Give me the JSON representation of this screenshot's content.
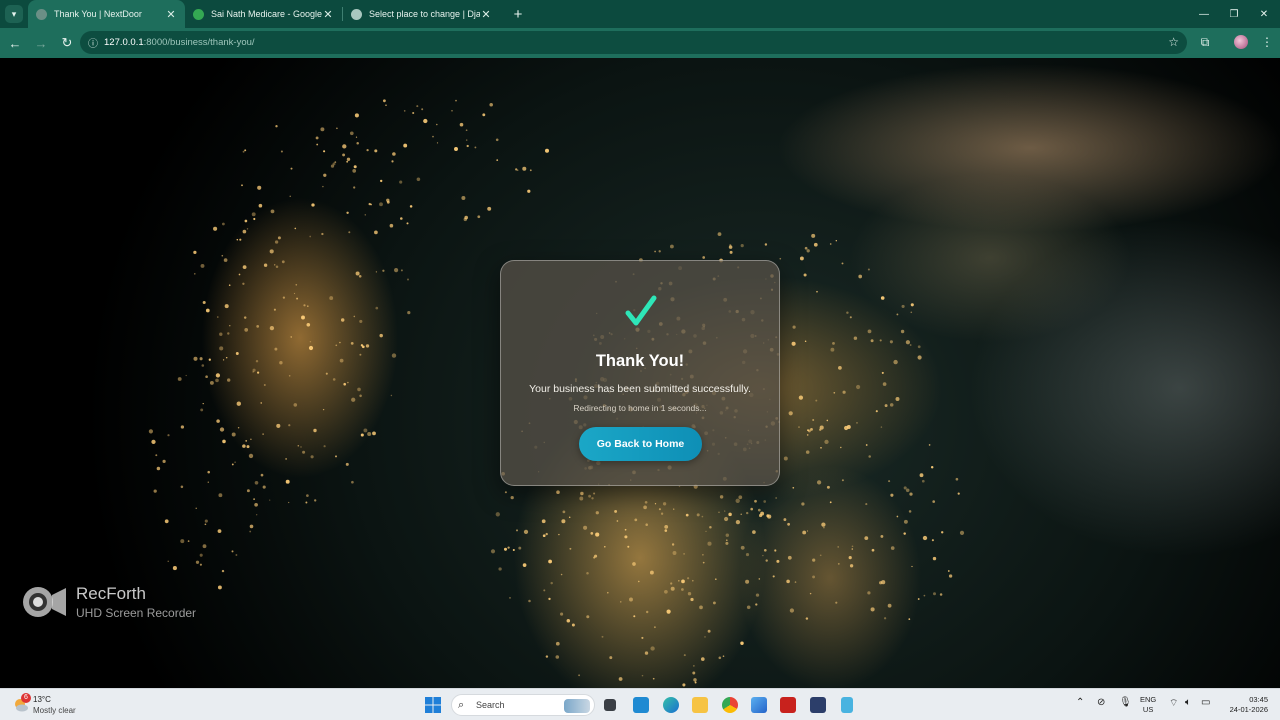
{
  "browser": {
    "tabs": [
      {
        "title": "Thank You | NextDoor",
        "active": true,
        "favicon_color": "#6b8f86"
      },
      {
        "title": "Sai Nath Medicare - Google Ma",
        "active": false,
        "favicon_color": "#34a853"
      },
      {
        "title": "Select place to change | Djang",
        "active": false,
        "favicon_color": "#a9c7bf"
      }
    ],
    "url_host": "127.0.0.1",
    "url_path": ":8000/business/thank-you/",
    "theme_color": "#1e6e5c"
  },
  "page": {
    "title": "Thank You!",
    "message": "Your business has been submitted successfully.",
    "redirect_text": "Redirecting to home in 1 seconds...",
    "button_label": "Go Back to Home",
    "check_color": "#2ee6b8",
    "button_color": "#1ba7c7"
  },
  "watermark": {
    "title": "RecForth",
    "subtitle": "UHD Screen Recorder"
  },
  "taskbar": {
    "weather_badge": "6",
    "weather_temp": "13°C",
    "weather_condition": "Mostly clear",
    "search_placeholder": "Search",
    "language": "ENG",
    "region": "US",
    "time": "03:45",
    "date": "24-01-2026",
    "apps": [
      "file-explorer-icon",
      "vscode-icon",
      "edge-icon",
      "folder-icon",
      "chrome-icon",
      "photos-icon",
      "acrobat-icon",
      "app-icon",
      "notepad-icon"
    ]
  }
}
